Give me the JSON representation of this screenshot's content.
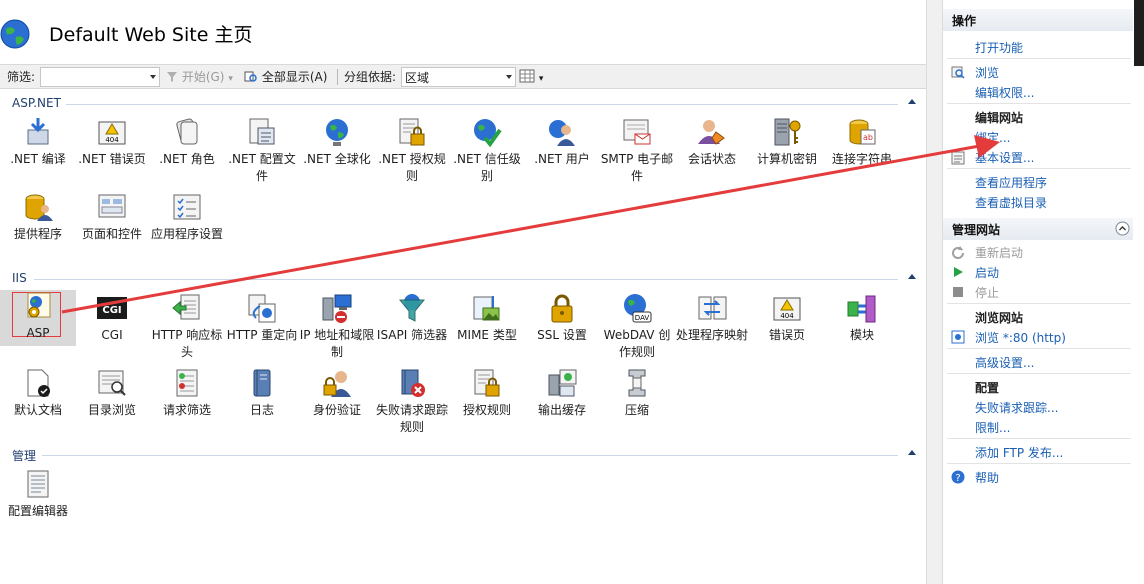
{
  "title": "Default Web Site 主页",
  "filter": {
    "label": "筛选:",
    "value": "",
    "start_label": "开始(G)",
    "show_all_label": "全部显示(A)",
    "group_by_label": "分组依据:",
    "group_by_value": "区域"
  },
  "sections": {
    "aspnet": "ASP.NET",
    "iis": "IIS",
    "management": "管理"
  },
  "aspnet_items": [
    {
      "label": ".NET 编译"
    },
    {
      "label": ".NET 错误页"
    },
    {
      "label": ".NET 角色"
    },
    {
      "label": ".NET 配置文件"
    },
    {
      "label": ".NET 全球化"
    },
    {
      "label": ".NET 授权规则"
    },
    {
      "label": ".NET 信任级别"
    },
    {
      "label": ".NET 用户"
    },
    {
      "label": "SMTP 电子邮件"
    },
    {
      "label": "会话状态"
    },
    {
      "label": "计算机密钥"
    },
    {
      "label": "连接字符串"
    },
    {
      "label": "提供程序"
    },
    {
      "label": "页面和控件"
    },
    {
      "label": "应用程序设置"
    }
  ],
  "iis_items": [
    {
      "label": "ASP"
    },
    {
      "label": "CGI"
    },
    {
      "label": "HTTP 响应标头"
    },
    {
      "label": "HTTP 重定向"
    },
    {
      "label": "IP 地址和域限制"
    },
    {
      "label": "ISAPI 筛选器"
    },
    {
      "label": "MIME 类型"
    },
    {
      "label": "SSL 设置"
    },
    {
      "label": "WebDAV 创作规则"
    },
    {
      "label": "处理程序映射"
    },
    {
      "label": "错误页"
    },
    {
      "label": "模块"
    },
    {
      "label": "默认文档"
    },
    {
      "label": "目录浏览"
    },
    {
      "label": "请求筛选"
    },
    {
      "label": "日志"
    },
    {
      "label": "身份验证"
    },
    {
      "label": "失败请求跟踪规则"
    },
    {
      "label": "授权规则"
    },
    {
      "label": "输出缓存"
    },
    {
      "label": "压缩"
    }
  ],
  "management_items": [
    {
      "label": "配置编辑器"
    }
  ],
  "actions": {
    "header": "操作",
    "open_feature": "打开功能",
    "browse": "浏览",
    "edit_permissions": "编辑权限...",
    "edit_site": "编辑网站",
    "bindings": "绑定...",
    "basic_settings": "基本设置...",
    "view_applications": "查看应用程序",
    "view_virtual_dirs": "查看虚拟目录",
    "manage_site_header": "管理网站",
    "restart": "重新启动",
    "start": "启动",
    "stop": "停止",
    "browse_site": "浏览网站",
    "browse_80": "浏览 *:80 (http)",
    "advanced_settings": "高级设置...",
    "configure": "配置",
    "failed_request_tracing": "失败请求跟踪...",
    "limits": "限制...",
    "add_ftp": "添加 FTP 发布...",
    "help": "帮助"
  },
  "colors": {
    "link": "#1a5fb4",
    "arrow": "#e43c3c",
    "section_text": "#1f3f6f"
  }
}
